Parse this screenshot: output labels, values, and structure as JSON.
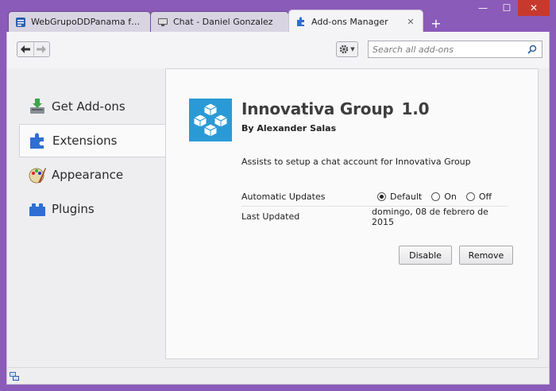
{
  "tabs": [
    {
      "label": "WebGrupoDDPanama feed - ...",
      "icon": "feed-icon"
    },
    {
      "label": "Chat - Daniel Gonzalez",
      "icon": "chat-icon"
    },
    {
      "label": "Add-ons Manager",
      "icon": "puzzle-icon",
      "active": true
    }
  ],
  "window": {
    "minimize": "—",
    "maximize": "☐",
    "close": "✕"
  },
  "toolbar": {
    "back": "🡐",
    "forward": "🡒",
    "search_placeholder": "Search all add-ons"
  },
  "categories": [
    {
      "label": "Get Add-ons",
      "icon": "download-icon"
    },
    {
      "label": "Extensions",
      "icon": "puzzle-icon",
      "selected": true
    },
    {
      "label": "Appearance",
      "icon": "paintbrush-icon"
    },
    {
      "label": "Plugins",
      "icon": "lego-brick-icon"
    }
  ],
  "addon": {
    "name": "Innovativa Group",
    "version": "1.0",
    "author": "By Alexander Salas",
    "description": "Assists to setup a chat account for Innovativa Group",
    "updates_label": "Automatic Updates",
    "updates_options": [
      "Default",
      "On",
      "Off"
    ],
    "updates_selected": "Default",
    "last_updated_label": "Last Updated",
    "last_updated_value": "domingo, 08 de febrero de 2015",
    "disable_label": "Disable",
    "remove_label": "Remove"
  },
  "colors": {
    "window_frame": "#8a5bb8",
    "accent_blue": "#2a9ad6"
  }
}
